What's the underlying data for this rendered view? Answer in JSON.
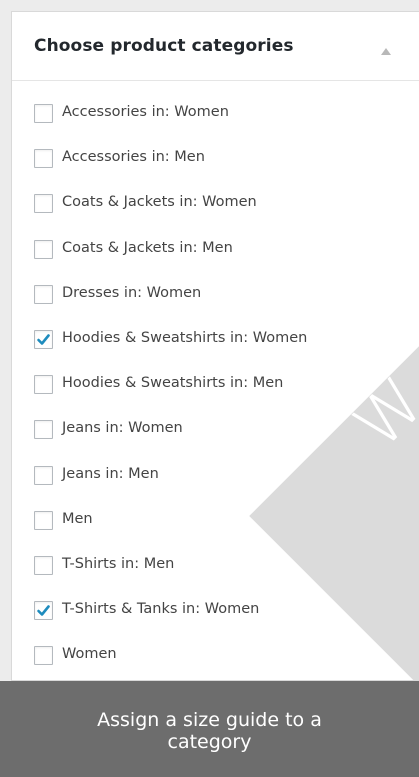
{
  "panel": {
    "title": "Choose product categories",
    "toggle_icon": "collapse-arrow-up-icon"
  },
  "categories": [
    {
      "label": "Accessories in: Women",
      "checked": false
    },
    {
      "label": "Accessories in: Men",
      "checked": false
    },
    {
      "label": "Coats & Jackets in: Women",
      "checked": false
    },
    {
      "label": "Coats & Jackets in: Men",
      "checked": false
    },
    {
      "label": "Dresses in: Women",
      "checked": false
    },
    {
      "label": "Hoodies & Sweatshirts in: Women",
      "checked": true
    },
    {
      "label": "Hoodies & Sweatshirts in: Men",
      "checked": false
    },
    {
      "label": "Jeans in: Women",
      "checked": false
    },
    {
      "label": "Jeans in: Men",
      "checked": false
    },
    {
      "label": "Men",
      "checked": false
    },
    {
      "label": "T-Shirts in: Men",
      "checked": false
    },
    {
      "label": "T-Shirts & Tanks in: Women",
      "checked": true
    },
    {
      "label": "Women",
      "checked": false
    }
  ],
  "watermark": {
    "text": "W"
  },
  "caption": {
    "text": "Assign a size guide to a category"
  },
  "colors": {
    "checkmark": "#1e8cbe",
    "caption_bg": "#6d6d6d"
  }
}
